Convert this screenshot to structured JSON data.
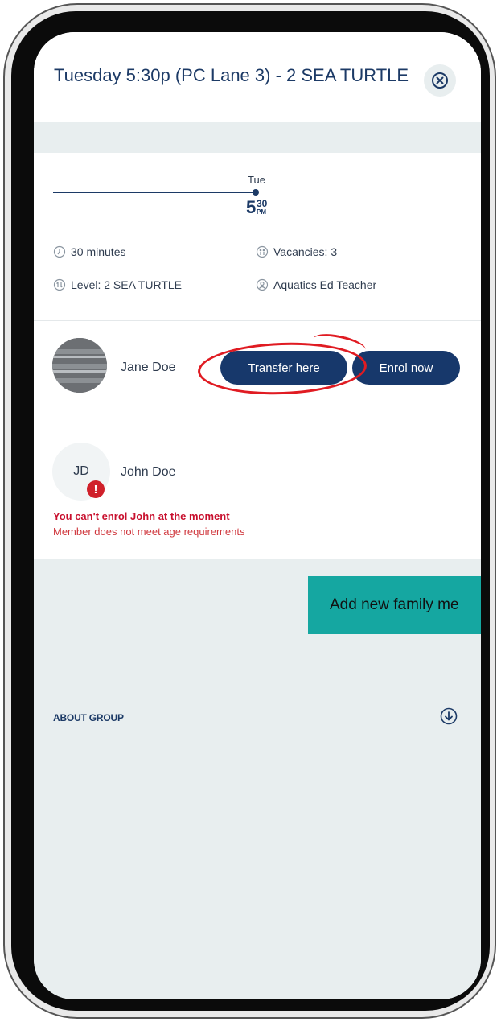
{
  "header": {
    "title": "Tuesday 5:30p (PC Lane 3) - 2 SEA TURTLE"
  },
  "icons": {
    "close": "close-circle-icon",
    "duration": "clock-icon",
    "vacancies": "people-icon",
    "level": "level-icon",
    "teacher": "teacher-icon",
    "alert": "alert-icon",
    "toggle": "arrow-down-circle-icon"
  },
  "timeline": {
    "day": "Tue",
    "hour": "5",
    "minutes": "30",
    "ampm": "PM"
  },
  "details": {
    "duration": "30 minutes",
    "vacancies": "Vacancies: 3",
    "level": "Level: 2 SEA TURTLE",
    "teacher": "Aquatics Ed Teacher"
  },
  "members": [
    {
      "name": "Jane Doe",
      "transfer_label": "Transfer here",
      "enrol_label": "Enrol now"
    },
    {
      "initials": "JD",
      "name": "John Doe",
      "alert_glyph": "!",
      "error_title": "You can't enrol John at the moment",
      "error_message": "Member does not meet age requirements"
    }
  ],
  "add_member_label": "Add new family me",
  "about": {
    "label": "ABOUT GROUP"
  },
  "colors": {
    "primary": "#17386b",
    "accent": "#15a7a1",
    "error": "#c8102e",
    "highlight": "#e01b22"
  }
}
